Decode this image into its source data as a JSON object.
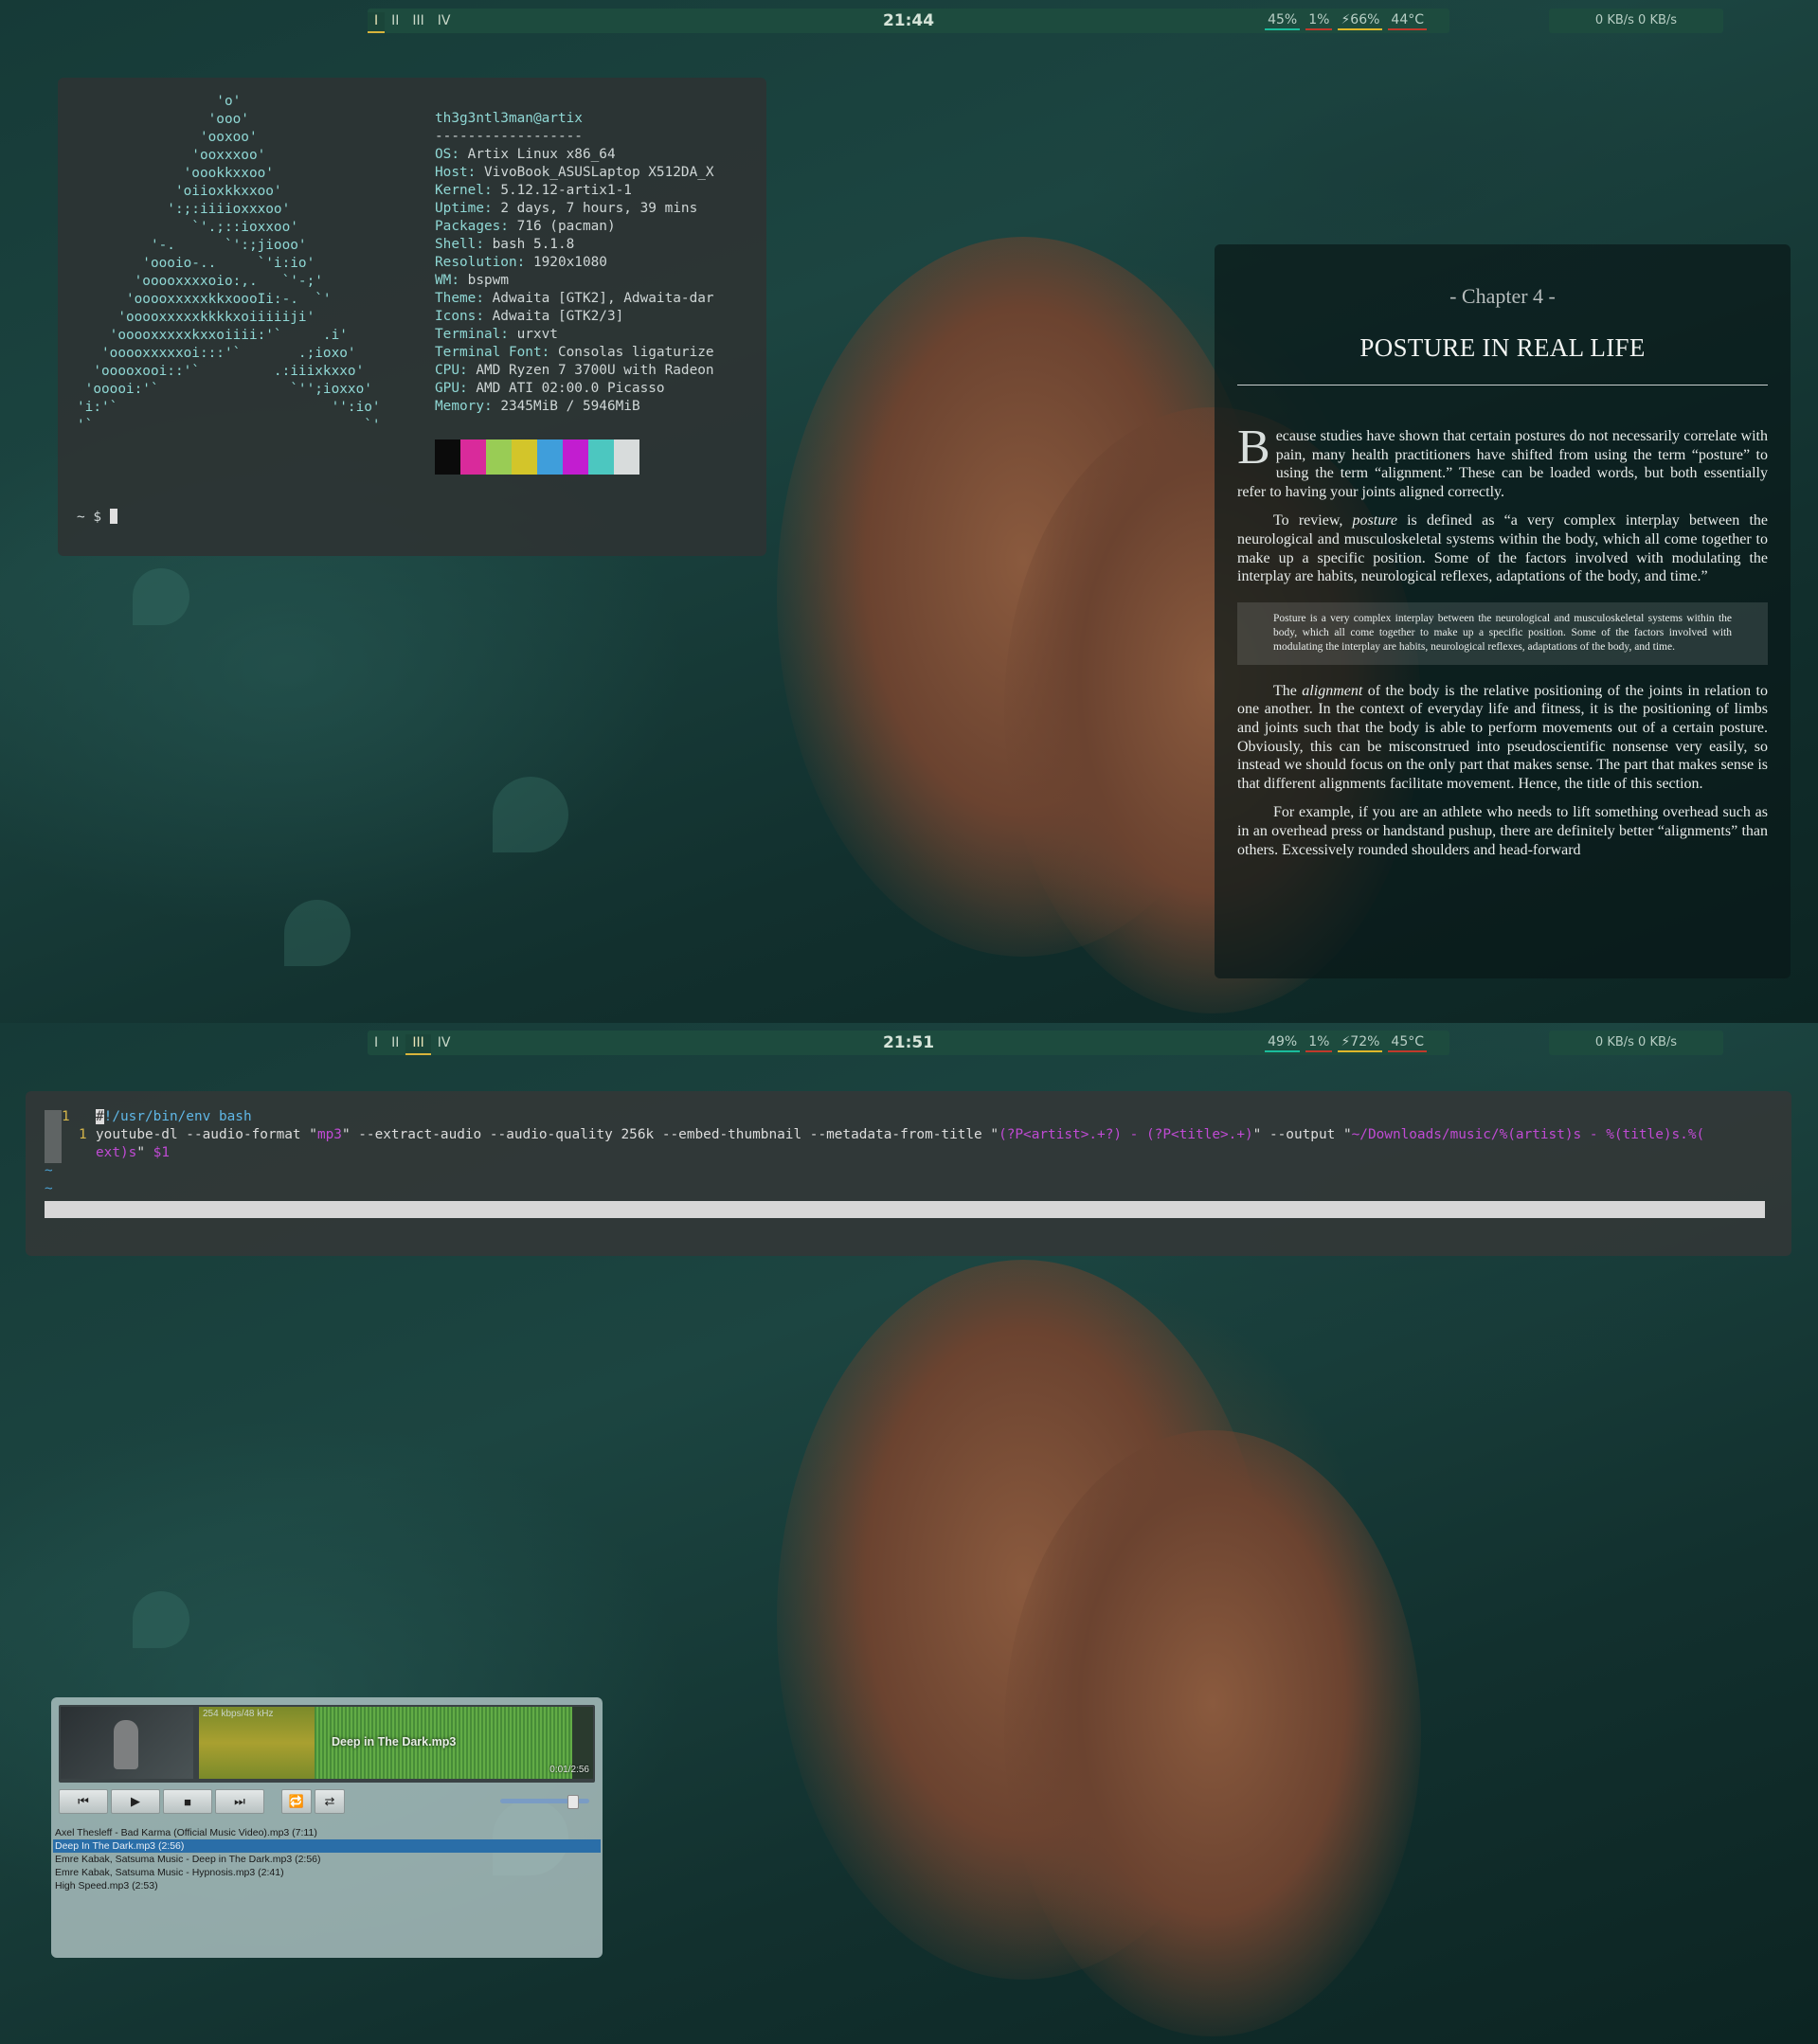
{
  "screen1": {
    "bar": {
      "workspaces": [
        "I",
        "II",
        "III",
        "IV"
      ],
      "active_workspace": "I",
      "clock": "21:44",
      "cpu": "45%",
      "mem": "1%",
      "battery": "⚡66%",
      "temp": "44°C",
      "net": "0 KB/s   0 KB/s"
    },
    "neofetch": {
      "ascii_art": "                 'o'\n                'ooo'\n               'ooxoo'\n              'ooxxxoo'\n             'oookkxxoo'\n            'oiioxkkxxoo'\n           ':;:iiiioxxxoo'\n              `'.;::ioxxoo'\n         '-.      `':;jiooo'\n        'oooio-..     `'i:io'\n       'ooooxxxxoio:,.   `'-;'\n      'ooooxxxxxkkxoooIi:-.  `'\n     'ooooxxxxxkkkkxoiiiiiji'\n    'ooooxxxxxkxxoiiii:'`     .i'\n   'ooooxxxxxoi:::'`       .;ioxo'\n  'ooooxooi::'`         .:iiixkxxo'\n 'ooooi:'`                `'';ioxxo'\n'i:'`                          '':io'\n'`                                 `'",
      "user_host": "th3g3ntl3man@artix",
      "separator": "------------------",
      "fields": [
        {
          "key": "OS",
          "value": " Artix Linux x86_64"
        },
        {
          "key": "Host",
          "value": " VivoBook_ASUSLaptop X512DA_X"
        },
        {
          "key": "Kernel",
          "value": " 5.12.12-artix1-1"
        },
        {
          "key": "Uptime",
          "value": " 2 days, 7 hours, 39 mins"
        },
        {
          "key": "Packages",
          "value": " 716 (pacman)"
        },
        {
          "key": "Shell",
          "value": " bash 5.1.8"
        },
        {
          "key": "Resolution",
          "value": " 1920x1080"
        },
        {
          "key": "WM",
          "value": " bspwm"
        },
        {
          "key": "Theme",
          "value": " Adwaita [GTK2], Adwaita-dar"
        },
        {
          "key": "Icons",
          "value": " Adwaita [GTK2/3]"
        },
        {
          "key": "Terminal",
          "value": " urxvt"
        },
        {
          "key": "Terminal Font",
          "value": " Consolas ligaturize"
        },
        {
          "key": "CPU",
          "value": " AMD Ryzen 7 3700U with Radeon"
        },
        {
          "key": "GPU",
          "value": " AMD ATI 02:00.0 Picasso"
        },
        {
          "key": "Memory",
          "value": " 2345MiB / 5946MiB"
        }
      ],
      "palette": [
        "#0b0b0b",
        "#d92a9b",
        "#99cc55",
        "#d3c52a",
        "#3f9edb",
        "#c21dd0",
        "#4cc7c0",
        "#d8dcdc"
      ],
      "prompt": "~ $ "
    },
    "reader": {
      "chapter": "- Chapter 4 -",
      "title": "POSTURE IN REAL LIFE",
      "dropcap": "B",
      "para1": "ecause studies have shown that certain postures do not necessarily correlate with pain, many health practitioners have shifted from using the term “posture” to using the term “alignment.” These can be loaded words, but both essentially refer to having your joints aligned correctly.",
      "para2_a": "To review, ",
      "para2_em": "posture",
      "para2_b": " is defined as “a very complex interplay between the neurological and musculoskeletal systems within the body, which all come together to make up a specific position. Some of the factors involved with modulating the interplay are habits, neurological reflexes, adaptations of the body, and time.”",
      "quote": "Posture is a very complex interplay between the neurological and musculoskeletal systems within the body, which all come together to make up a specific position. Some of the factors involved with modulating the interplay are habits, neurological reflexes, adaptations of the body, and time.",
      "para3_a": "The ",
      "para3_em": "alignment",
      "para3_b": " of the body is the relative positioning of the joints in relation to one another. In the context of everyday life and fitness, it is the positioning of limbs and joints such that the body is able to perform movements out of a certain posture. Obviously, this can be misconstrued into pseudoscientific nonsense very easily, so instead we should focus on the only part that makes sense. The part that makes sense is that different alignments facilitate movement. Hence, the title of this section.",
      "para4": "For example, if you are an athlete who needs to lift something overhead such as in an overhead press or handstand pushup, there are definitely better “alignments” than others. Excessively rounded shoulders and head-forward"
    }
  },
  "screen2": {
    "bar": {
      "workspaces": [
        "I",
        "II",
        "III",
        "IV"
      ],
      "active_workspace": "III",
      "clock": "21:51",
      "cpu": "49%",
      "mem": "1%",
      "battery": "⚡72%",
      "temp": "45°C",
      "net": "0 KB/s   0 KB/s"
    },
    "vim": {
      "line_numbers": [
        "1",
        "1"
      ],
      "line1_cursor": "#",
      "line1_rest": "!/usr/bin/env bash",
      "line2_pre": "youtube-dl --audio-format \"",
      "line2_str1": "mp3",
      "line2_mid": "\" --extract-audio --audio-quality 256k --embed-thumbnail --metadata-from-title \"",
      "line2_str2": "(?P<artist>.+?) - (?P<title>.+)",
      "line2_mid2": "\" --output \"",
      "line2_str3": "~/Downloads/music/%(artist)s - %(title)s.%(",
      "line3_str": "ext)s",
      "line3_mid": "\" ",
      "line3_var": "$1",
      "tilde": "~"
    },
    "player": {
      "bitrate": "254 kbps/48 kHz",
      "current_file": "Deep in The Dark.mp3",
      "time": "0:01/2:56",
      "progress_fraction": 0.31,
      "volume_fraction": 0.85,
      "playlist": [
        "Axel Thesleff - Bad Karma (Official Music Video).mp3 (7:11)",
        "Deep In The Dark.mp3 (2:56)",
        "Emre Kabak, Satsuma Music - Deep in The Dark.mp3 (2:56)",
        "Emre Kabak, Satsuma Music - Hypnosis.mp3 (2:41)",
        "High Speed.mp3 (2:53)"
      ],
      "selected_index": 1
    }
  }
}
